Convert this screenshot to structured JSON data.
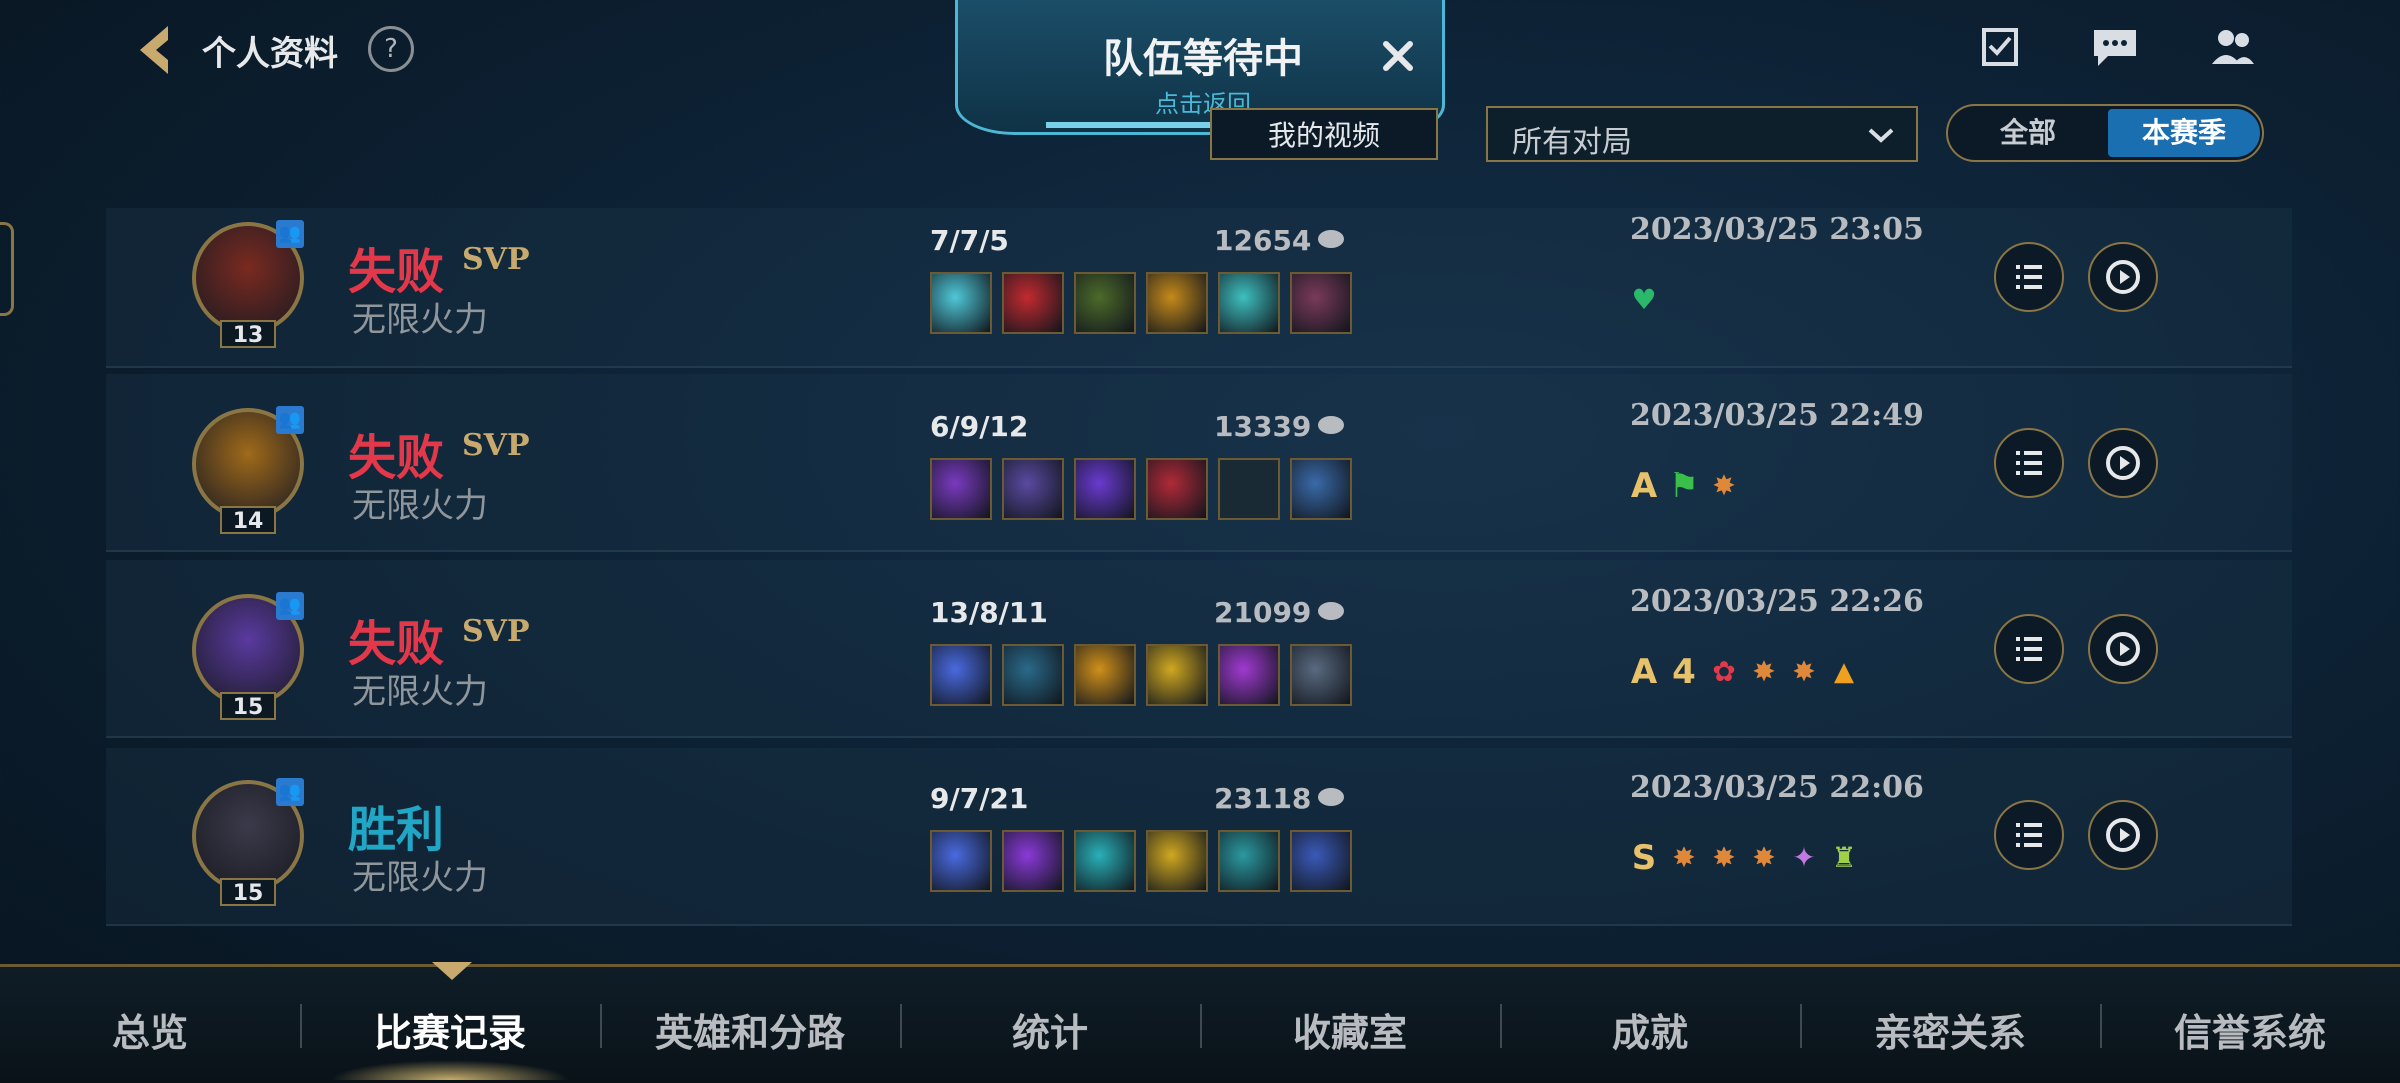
{
  "header": {
    "back_label": "个人资料",
    "help_label": "?"
  },
  "queue_banner": {
    "title": "队伍等待中",
    "subtitle": "点击返回"
  },
  "filters": {
    "my_videos": "我的视频",
    "match_filter": "所有对局",
    "toggle_all": "全部",
    "toggle_season": "本赛季"
  },
  "matches": [
    {
      "result": "失败",
      "result_type": "loss",
      "badge": "SVP",
      "mode": "无限火力",
      "level": "13",
      "kda": "7/7/5",
      "gold": "12654",
      "datetime": "2023/03/25 23:05",
      "item_colors": [
        "#4fc8d8",
        "#c22a30",
        "#4d6a2a",
        "#c58a1a",
        "#3ec0c0",
        "#7a3a5a"
      ],
      "tags": [
        "heart"
      ]
    },
    {
      "result": "失败",
      "result_type": "loss",
      "badge": "SVP",
      "mode": "无限火力",
      "level": "14",
      "kda": "6/9/12",
      "gold": "13339",
      "datetime": "2023/03/25 22:49",
      "item_colors": [
        "#7a3ac0",
        "#5a4aa0",
        "#6a3ad0",
        "#b02a38",
        "#1a2a34",
        "#3a6aa8"
      ],
      "tags": [
        "A",
        "flag",
        "leaf"
      ]
    },
    {
      "result": "失败",
      "result_type": "loss",
      "badge": "SVP",
      "mode": "无限火力",
      "level": "15",
      "kda": "13/8/11",
      "gold": "21099",
      "datetime": "2023/03/25 22:26",
      "item_colors": [
        "#4a6ae0",
        "#2a6a8a",
        "#d0901a",
        "#d0a820",
        "#a03ad0",
        "#5a6a80"
      ],
      "tags": [
        "A",
        "4",
        "lotus",
        "crown",
        "leaf",
        "fire"
      ]
    },
    {
      "result": "胜利",
      "result_type": "win",
      "badge": "",
      "mode": "无限火力",
      "level": "15",
      "kda": "9/7/21",
      "gold": "23118",
      "datetime": "2023/03/25 22:06",
      "item_colors": [
        "#4a6ae0",
        "#8a3ad8",
        "#2ab0b8",
        "#d0a820",
        "#2a9aa0",
        "#3a5ab8"
      ],
      "tags": [
        "S",
        "crown",
        "skull",
        "chain",
        "wings",
        "totem"
      ]
    }
  ],
  "tabs": [
    "总览",
    "比赛记录",
    "英雄和分路",
    "统计",
    "收藏室",
    "成就",
    "亲密关系",
    "信誉系统"
  ],
  "colors": {
    "loss": "#e2384a",
    "win": "#22a6c6",
    "gold_accent": "#c8aa6e"
  }
}
